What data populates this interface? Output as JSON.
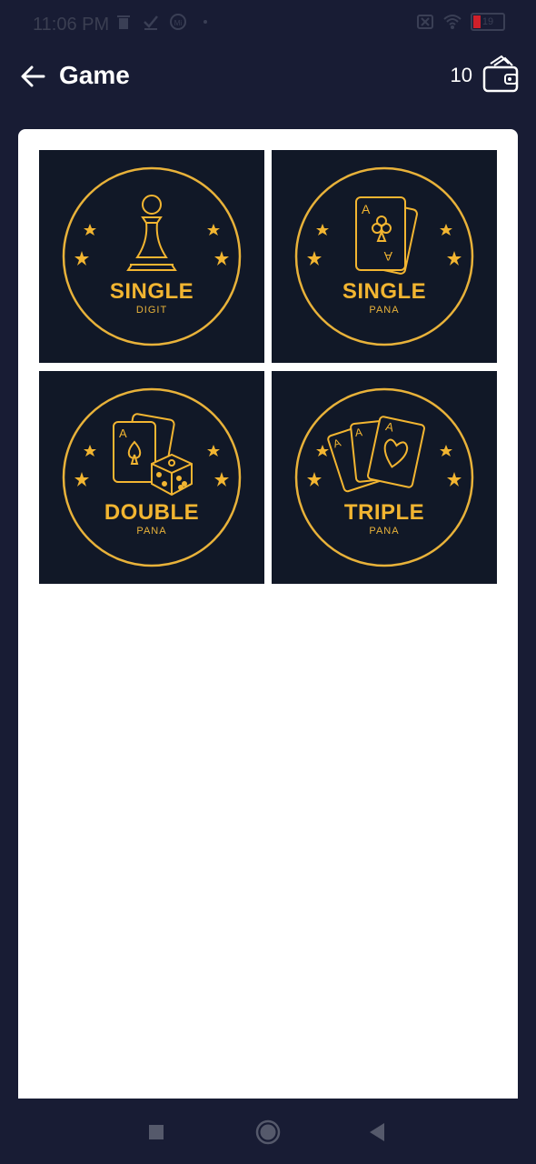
{
  "status_bar": {
    "time": "11:06 PM",
    "battery_level": "19",
    "icons_left": [
      "trash-icon",
      "check-icon",
      "sim-icon",
      "dot-icon"
    ],
    "icons_right": [
      "no-sim-icon",
      "wifi-icon",
      "battery-icon"
    ]
  },
  "header": {
    "title": "Game",
    "wallet_balance": "10"
  },
  "games": [
    {
      "title": "SINGLE",
      "subtitle": "DIGIT",
      "icon": "pawn-icon"
    },
    {
      "title": "SINGLE",
      "subtitle": "PANA",
      "icon": "card-club-icon"
    },
    {
      "title": "DOUBLE",
      "subtitle": "PANA",
      "icon": "cards-dice-icon"
    },
    {
      "title": "TRIPLE",
      "subtitle": "PANA",
      "icon": "three-cards-icon"
    }
  ],
  "colors": {
    "background": "#181c34",
    "tile": "#111827",
    "gold": "#f2b531",
    "card": "#ffffff"
  },
  "nav": [
    "recents-button",
    "home-button",
    "back-button"
  ]
}
